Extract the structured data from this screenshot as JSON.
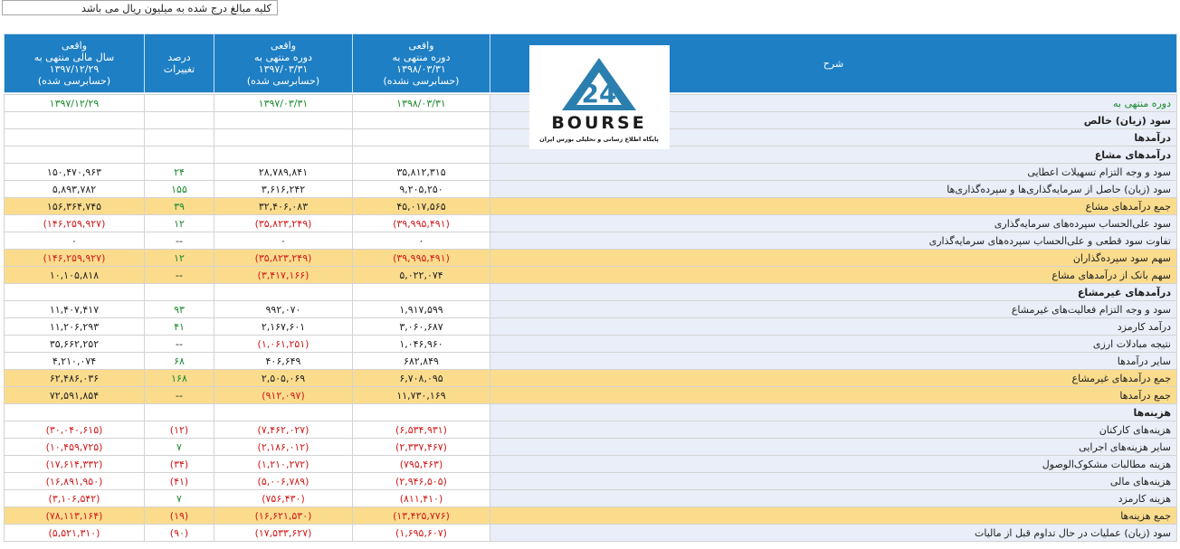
{
  "note": "کلیه مبالغ درج شده به میلیون ریال می باشد",
  "header": {
    "desc": "شرح",
    "col1": [
      "واقعی",
      "دوره منتهی به",
      "۱۳۹۸/۰۳/۳۱",
      "(حسابرسی نشده)"
    ],
    "col2": [
      "واقعی",
      "دوره منتهی به",
      "۱۳۹۷/۰۳/۳۱",
      "(حسابرسی شده)"
    ],
    "col_pct": [
      "درصد",
      "تغییرات"
    ],
    "col3": [
      "واقعی",
      "سال مالی منتهی به",
      "۱۳۹۷/۱۲/۲۹",
      "(حسابرسی شده)"
    ]
  },
  "logo": {
    "numeral": "24",
    "wordmark": "BOURSE",
    "tagline": "پایگاه اطلاع رسانی و تحلیلی بورس ایران",
    "brand_color": "#2a7fae"
  },
  "colors": {
    "header_bg": "#1e7fc4",
    "desc_bg": "#e9eef8",
    "total_bg": "#fbdc8d",
    "negative": "#d21a1a",
    "positive": "#1c8a2e"
  },
  "rows": [
    {
      "type": "period",
      "desc": "دوره منتهی به",
      "v1": "۱۳۹۸/۰۳/۳۱",
      "v2": "۱۳۹۷/۰۳/۳۱",
      "pct": "",
      "v3": "۱۳۹۷/۱۲/۲۹"
    },
    {
      "type": "bold",
      "desc": "سود (زیان) خالص",
      "v1": "",
      "v2": "",
      "pct": "",
      "v3": ""
    },
    {
      "type": "bold",
      "desc": "درآمدها",
      "v1": "",
      "v2": "",
      "pct": "",
      "v3": ""
    },
    {
      "type": "bold",
      "desc": "درآمدهای مشاع",
      "v1": "",
      "v2": "",
      "pct": "",
      "v3": ""
    },
    {
      "type": "normal",
      "desc": "سود و وجه التزام تسهیلات اعطایی",
      "v1": "۳۵,۸۱۲,۳۱۵",
      "v2": "۲۸,۷۸۹,۸۴۱",
      "pct": "۲۴",
      "v3": "۱۵۰,۴۷۰,۹۶۳"
    },
    {
      "type": "normal",
      "desc": "سود (زیان) حاصل از سرمایه‌گذاری‌ها و سپرده‌گذاری‌ها",
      "v1": "۹,۲۰۵,۲۵۰",
      "v2": "۳,۶۱۶,۲۴۲",
      "pct": "۱۵۵",
      "v3": "۵,۸۹۳,۷۸۲"
    },
    {
      "type": "total",
      "desc": "جمع درآمدهای مشاع",
      "v1": "۴۵,۰۱۷,۵۶۵",
      "v2": "۳۲,۴۰۶,۰۸۳",
      "pct": "۳۹",
      "v3": "۱۵۶,۳۶۴,۷۴۵"
    },
    {
      "type": "normal",
      "desc": "سود علی‌الحساب سپرده‌های سرمایه‌گذاری",
      "v1": "(۳۹,۹۹۵,۴۹۱)",
      "v2": "(۳۵,۸۲۳,۲۴۹)",
      "pct": "۱۲",
      "v3": "(۱۴۶,۲۵۹,۹۲۷)"
    },
    {
      "type": "normal",
      "desc": "تفاوت سود قطعی و علی‌الحساب سپرده‌های سرمایه‌گذاری",
      "v1": "۰",
      "v2": "۰",
      "pct": "--",
      "v3": "۰"
    },
    {
      "type": "total",
      "desc": "سهم سود سپرده‌گذاران",
      "v1": "(۳۹,۹۹۵,۴۹۱)",
      "v2": "(۳۵,۸۲۳,۲۴۹)",
      "pct": "۱۲",
      "v3": "(۱۴۶,۲۵۹,۹۲۷)"
    },
    {
      "type": "total",
      "desc": "سهم بانک از درآمدهای مشاع",
      "v1": "۵,۰۲۲,۰۷۴",
      "v2": "(۳,۴۱۷,۱۶۶)",
      "pct": "--",
      "v3": "۱۰,۱۰۵,۸۱۸"
    },
    {
      "type": "bold",
      "desc": "درآمدهای غیرمشاع",
      "v1": "",
      "v2": "",
      "pct": "",
      "v3": ""
    },
    {
      "type": "normal",
      "desc": "سود و وجه التزام فعالیت‌های غیرمشاع",
      "v1": "۱,۹۱۷,۵۹۹",
      "v2": "۹۹۲,۰۷۰",
      "pct": "۹۳",
      "v3": "۱۱,۴۰۷,۴۱۷"
    },
    {
      "type": "normal",
      "desc": "درآمد کارمزد",
      "v1": "۳,۰۶۰,۶۸۷",
      "v2": "۲,۱۶۷,۶۰۱",
      "pct": "۴۱",
      "v3": "۱۱,۲۰۶,۲۹۳"
    },
    {
      "type": "normal",
      "desc": "نتیجه مبادلات ارزی",
      "v1": "۱,۰۴۶,۹۶۰",
      "v2": "(۱,۰۶۱,۲۵۱)",
      "pct": "--",
      "v3": "۳۵,۶۶۲,۲۵۲"
    },
    {
      "type": "normal",
      "desc": "سایر درآمدها",
      "v1": "۶۸۲,۸۴۹",
      "v2": "۴۰۶,۶۴۹",
      "pct": "۶۸",
      "v3": "۴,۲۱۰,۰۷۴"
    },
    {
      "type": "total",
      "desc": "جمع درآمدهای غیرمشاع",
      "v1": "۶,۷۰۸,۰۹۵",
      "v2": "۲,۵۰۵,۰۶۹",
      "pct": "۱۶۸",
      "v3": "۶۲,۴۸۶,۰۳۶"
    },
    {
      "type": "total",
      "desc": "جمع درآمدها",
      "v1": "۱۱,۷۳۰,۱۶۹",
      "v2": "(۹۱۲,۰۹۷)",
      "pct": "--",
      "v3": "۷۲,۵۹۱,۸۵۴"
    },
    {
      "type": "bold",
      "desc": "هزینه‌ها",
      "v1": "",
      "v2": "",
      "pct": "",
      "v3": ""
    },
    {
      "type": "normal",
      "desc": "هزینه‌های کارکنان",
      "v1": "(۶,۵۳۴,۹۳۱)",
      "v2": "(۷,۴۶۲,۰۲۷)",
      "pct": "(۱۲)",
      "v3": "(۳۰,۰۴۰,۶۱۵)"
    },
    {
      "type": "normal",
      "desc": "سایر هزینه‌های اجرایی",
      "v1": "(۲,۳۳۷,۴۶۷)",
      "v2": "(۲,۱۸۶,۰۱۲)",
      "pct": "۷",
      "v3": "(۱۰,۴۵۹,۷۲۵)"
    },
    {
      "type": "normal",
      "desc": "هزینه مطالبات مشکوک‌الوصول",
      "v1": "(۷۹۵,۴۶۳)",
      "v2": "(۱,۲۱۰,۲۷۲)",
      "pct": "(۳۴)",
      "v3": "(۱۷,۶۱۴,۳۳۲)"
    },
    {
      "type": "normal",
      "desc": "هزینه‌های مالی",
      "v1": "(۲,۹۴۶,۵۰۵)",
      "v2": "(۵,۰۰۶,۷۸۹)",
      "pct": "(۴۱)",
      "v3": "(۱۶,۸۹۱,۹۵۰)"
    },
    {
      "type": "normal",
      "desc": "هزینه کارمزد",
      "v1": "(۸۱۱,۴۱۰)",
      "v2": "(۷۵۶,۴۳۰)",
      "pct": "۷",
      "v3": "(۳,۱۰۶,۵۴۲)"
    },
    {
      "type": "total",
      "desc": "جمع هزینه‌ها",
      "v1": "(۱۳,۴۲۵,۷۷۶)",
      "v2": "(۱۶,۶۲۱,۵۳۰)",
      "pct": "(۱۹)",
      "v3": "(۷۸,۱۱۳,۱۶۴)"
    },
    {
      "type": "normal",
      "desc": "سود (زیان) عملیات در حال تداوم قبل از مالیات",
      "v1": "(۱,۶۹۵,۶۰۷)",
      "v2": "(۱۷,۵۳۳,۶۲۷)",
      "pct": "(۹۰)",
      "v3": "(۵,۵۲۱,۳۱۰)"
    }
  ]
}
